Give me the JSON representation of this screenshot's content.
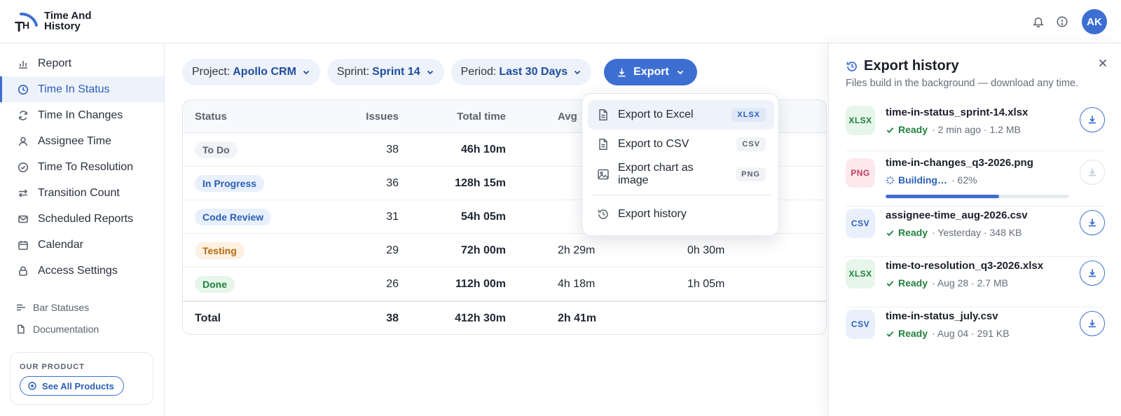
{
  "brand": {
    "line1": "Time And",
    "line2": "History",
    "logo_text": "TH"
  },
  "header": {
    "avatar_initials": "AK",
    "icons": [
      "bell-icon",
      "info-icon"
    ]
  },
  "sidebar": {
    "items": [
      {
        "label": "Report",
        "icon": "bar-chart-icon",
        "active": false
      },
      {
        "label": "Time In Status",
        "icon": "clock-icon",
        "active": true
      },
      {
        "label": "Time In Changes",
        "icon": "refresh-icon",
        "active": false
      },
      {
        "label": "Assignee Time",
        "icon": "user-icon",
        "active": false
      },
      {
        "label": "Time To Resolution",
        "icon": "check-circle-icon",
        "active": false
      },
      {
        "label": "Transition Count",
        "icon": "arrows-icon",
        "active": false
      },
      {
        "label": "Scheduled Reports",
        "icon": "mail-icon",
        "active": false
      },
      {
        "label": "Calendar",
        "icon": "calendar-icon",
        "active": false
      },
      {
        "label": "Access Settings",
        "icon": "lock-icon",
        "active": false
      }
    ],
    "secondary": [
      {
        "label": "Bar Statuses",
        "icon": "bars-icon"
      },
      {
        "label": "Documentation",
        "icon": "document-icon"
      }
    ],
    "product": {
      "label": "OUR PRODUCT",
      "button": "See All Products"
    }
  },
  "filters": {
    "project": {
      "key": "Project:",
      "value": "Apollo CRM"
    },
    "sprint": {
      "key": "Sprint:",
      "value": "Sprint 14"
    },
    "period": {
      "key": "Period:",
      "value": "Last 30 Days"
    },
    "export_label": "Export"
  },
  "table": {
    "headers": {
      "status": "Status",
      "issues": "Issues",
      "total": "Total time",
      "avg": "Avg"
    },
    "rows": [
      {
        "status": "To Do",
        "issues": "38",
        "total": "46h 10m",
        "avg": "",
        "median": "",
        "color": "#f1f3f6",
        "text": "#5b6370"
      },
      {
        "status": "In Progress",
        "issues": "36",
        "total": "128h 15m",
        "avg": "",
        "median": "",
        "color": "#e8f0fd",
        "text": "#2a5fb8"
      },
      {
        "status": "Code Review",
        "issues": "31",
        "total": "54h 05m",
        "avg": "",
        "median": "",
        "color": "#e8f0fd",
        "text": "#2a5fb8"
      },
      {
        "status": "Testing",
        "issues": "29",
        "total": "72h 00m",
        "avg": "2h 29m",
        "median": "0h 30m",
        "color": "#fdf1e1",
        "text": "#b26a12"
      },
      {
        "status": "Done",
        "issues": "26",
        "total": "112h 00m",
        "avg": "4h 18m",
        "median": "1h 05m",
        "color": "#e6f6ea",
        "text": "#23813f"
      }
    ],
    "total": {
      "label": "Total",
      "issues": "38",
      "total": "412h 30m",
      "avg": "2h 41m"
    }
  },
  "export_menu": {
    "items": [
      {
        "label": "Export to Excel",
        "tag": "XLSX",
        "icon": "file-icon"
      },
      {
        "label": "Export to CSV",
        "tag": "CSV",
        "icon": "file-icon"
      },
      {
        "label": "Export chart as image",
        "tag": "PNG",
        "icon": "image-icon"
      }
    ],
    "history_label": "Export history"
  },
  "history": {
    "title": "Export history",
    "subtitle": "Files build in the background — download any time.",
    "files": [
      {
        "type": "XLSX",
        "name": "time-in-status_sprint-14.xlsx",
        "status": "Ready",
        "meta": "· 2 min ago · 1.2 MB",
        "badge_bg": "#e6f6ea",
        "badge_fg": "#23813f",
        "state": "ready"
      },
      {
        "type": "PNG",
        "name": "time-in-changes_q3-2026.png",
        "status": "Building…",
        "meta": "· 62%",
        "badge_bg": "#fde8ee",
        "badge_fg": "#c23a5e",
        "state": "building",
        "progress": 0.62
      },
      {
        "type": "CSV",
        "name": "assignee-time_aug-2026.csv",
        "status": "Ready",
        "meta": "· Yesterday · 348 KB",
        "badge_bg": "#eaf0fb",
        "badge_fg": "#2a5fb8",
        "state": "ready"
      },
      {
        "type": "XLSX",
        "name": "time-to-resolution_q3-2026.xlsx",
        "status": "Ready",
        "meta": "· Aug 28 · 2.7 MB",
        "badge_bg": "#e6f6ea",
        "badge_fg": "#23813f",
        "state": "ready"
      },
      {
        "type": "CSV",
        "name": "time-in-status_july.csv",
        "status": "Ready",
        "meta": "· Aug 04 · 291 KB",
        "badge_bg": "#eaf0fb",
        "badge_fg": "#2a5fb8",
        "state": "ready"
      }
    ]
  },
  "colors": {
    "accent": "#3d6fd2",
    "ready": "#23813f",
    "building": "#2a5fb8"
  }
}
